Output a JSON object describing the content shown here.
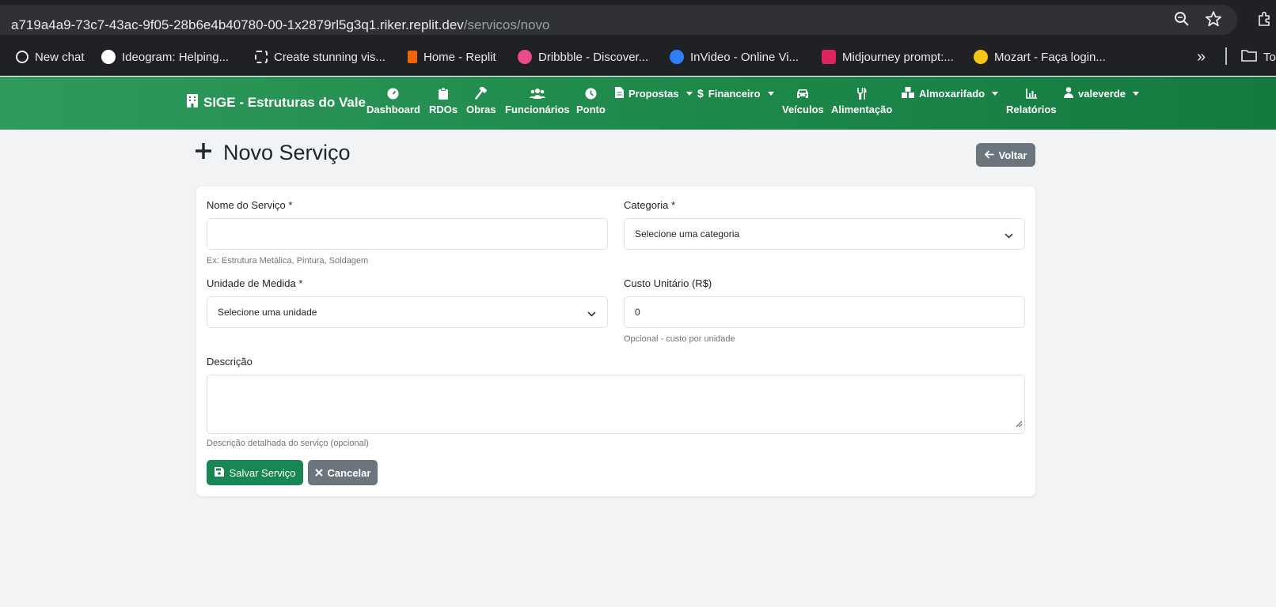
{
  "browser": {
    "url_host": "a719a4a9-73c7-43ac-9f05-28b6e4b40780-00-1x2879rl5g3q1.riker.replit.dev",
    "url_path": "/servicos/novo",
    "bookmarks": [
      {
        "label": "New chat",
        "color": "#cccccc"
      },
      {
        "label": "Ideogram: Helping...",
        "color": "#ffffff"
      },
      {
        "label": "Create stunning vis...",
        "color": "#202124"
      },
      {
        "label": "Home - Replit",
        "color": "#f26207"
      },
      {
        "label": "Dribbble - Discover...",
        "color": "#ea4c89"
      },
      {
        "label": "InVideo - Online Vi...",
        "color": "#2d7ff9"
      },
      {
        "label": "Midjourney prompt:...",
        "color": "#e0245e"
      },
      {
        "label": "Mozart - Faça login...",
        "color": "#f5c518"
      }
    ],
    "overflow_label": "»",
    "folder_label": "To"
  },
  "navbar": {
    "brand": "SIGE - Estruturas do Vale",
    "items": [
      {
        "label": "Dashboard",
        "icon": "gauge-icon"
      },
      {
        "label": "RDOs",
        "icon": "clipboard-icon"
      },
      {
        "label": "Obras",
        "icon": "hammer-icon"
      },
      {
        "label": "Funcionários",
        "icon": "users-icon"
      },
      {
        "label": "Ponto",
        "icon": "clock-icon"
      },
      {
        "label": "Veículos",
        "icon": "car-icon"
      },
      {
        "label": "Alimentação",
        "icon": "utensils-icon"
      },
      {
        "label": "Relatórios",
        "icon": "chart-icon"
      }
    ],
    "dropdowns": {
      "propostas": "Propostas",
      "financeiro": "Financeiro",
      "almoxarifado": "Almoxarifado",
      "user": "valeverde"
    }
  },
  "page": {
    "title": "Novo Serviço",
    "back_label": "Voltar"
  },
  "form": {
    "nome_label": "Nome do Serviço *",
    "nome_value": "",
    "nome_help": "Ex: Estrutura Metálica, Pintura, Soldagem",
    "categoria_label": "Categoria *",
    "categoria_value": "Selecione uma categoria",
    "unidade_label": "Unidade de Medida *",
    "unidade_value": "Selecione uma unidade",
    "custo_label": "Custo Unitário (R$)",
    "custo_value": "0",
    "custo_help": "Opcional - custo por unidade",
    "descricao_label": "Descrição",
    "descricao_value": "",
    "descricao_help": "Descrição detalhada do serviço (opcional)",
    "save_label": "Salvar Serviço",
    "cancel_label": "Cancelar"
  },
  "colors": {
    "navbar": "#1f8a4c",
    "primary": "#198754",
    "secondary": "#6c757d"
  }
}
